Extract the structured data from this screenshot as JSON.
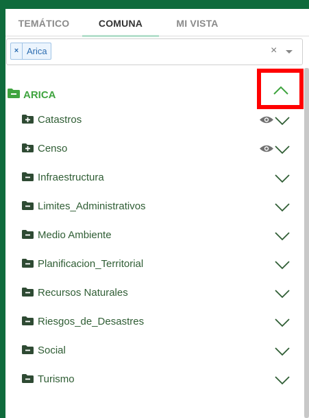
{
  "tabs": [
    {
      "label": "TEMÁTICO",
      "active": false
    },
    {
      "label": "COMUNA",
      "active": true
    },
    {
      "label": "MI VISTA",
      "active": false
    }
  ],
  "select": {
    "chip_remove": "×",
    "chip_label": "Arica",
    "clear": "×"
  },
  "region": {
    "label": "ARICA",
    "expanded": true
  },
  "items": [
    {
      "label": "Catastros",
      "icon": "folder-plus-icon",
      "visible_toggle": true
    },
    {
      "label": "Censo",
      "icon": "folder-plus-icon",
      "visible_toggle": true
    },
    {
      "label": "Infraestructura",
      "icon": "folder-minus-icon",
      "visible_toggle": false
    },
    {
      "label": "Limites_Administrativos",
      "icon": "folder-minus-icon",
      "visible_toggle": false
    },
    {
      "label": "Medio Ambiente",
      "icon": "folder-minus-icon",
      "visible_toggle": false
    },
    {
      "label": "Planificacion_Territorial",
      "icon": "folder-minus-icon",
      "visible_toggle": false
    },
    {
      "label": "Recursos Naturales",
      "icon": "folder-minus-icon",
      "visible_toggle": false
    },
    {
      "label": "Riesgos_de_Desastres",
      "icon": "folder-minus-icon",
      "visible_toggle": false
    },
    {
      "label": "Social",
      "icon": "folder-minus-icon",
      "visible_toggle": false
    },
    {
      "label": "Turismo",
      "icon": "folder-minus-icon",
      "visible_toggle": false
    }
  ],
  "colors": {
    "background": "#0f6b3c",
    "region_green": "#3fa43f",
    "item_text": "#2f5d34",
    "icon_dark": "#2e4a33",
    "chevron": "#2f5d34",
    "highlight": "#ff0000",
    "chip_blue": "#2b6cb0"
  }
}
